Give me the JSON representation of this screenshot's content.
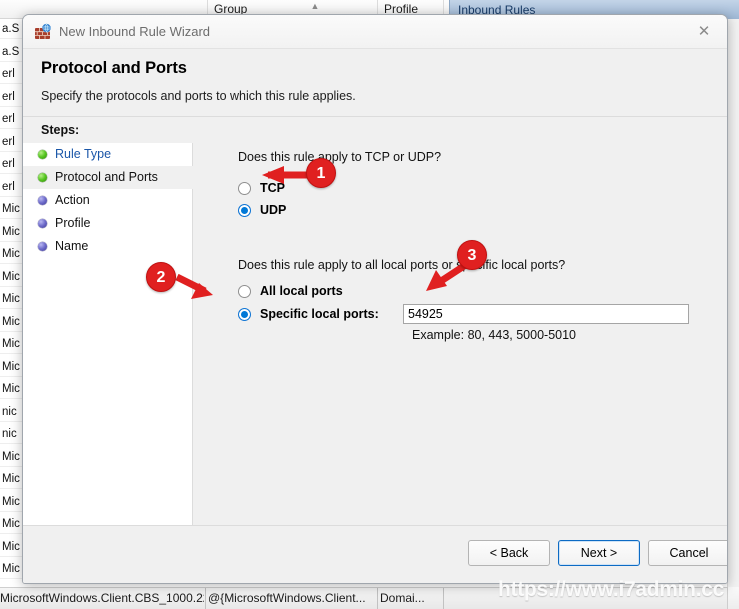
{
  "background": {
    "columns": [
      "",
      "",
      "Group",
      "Profile",
      ""
    ],
    "col_group": "Group",
    "col_profile": "Profile",
    "action_pane_title": "Inbound Rules",
    "rows": [
      "a.S",
      "a.S",
      "erl",
      "erl",
      "erl",
      "erl",
      "erl",
      "erl",
      "Mic",
      "Mic",
      "Mic",
      "Mic",
      "Mic",
      "Mic",
      "Mic",
      "Mic",
      "Mic",
      "nic",
      "nic",
      "Mic",
      "Mic",
      "Mic",
      "Mic",
      "Mic",
      "Mic"
    ],
    "status": {
      "cell1": "MicrosoftWindows.Client.CBS_1000.22...",
      "cell2": "@{MicrosoftWindows.Client...",
      "cell3": "Domai..."
    }
  },
  "dialog": {
    "title": "New Inbound Rule Wizard",
    "title_icon": "firewall-icon",
    "close_icon": "close-icon",
    "page_title": "Protocol and Ports",
    "page_subtitle": "Specify the protocols and ports to which this rule applies.",
    "steps_header": "Steps:",
    "steps": [
      {
        "label": "Rule Type",
        "state": "done",
        "current": false,
        "link": true
      },
      {
        "label": "Protocol and Ports",
        "state": "done",
        "current": true,
        "link": false
      },
      {
        "label": "Action",
        "state": "todo",
        "current": false,
        "link": false
      },
      {
        "label": "Profile",
        "state": "todo",
        "current": false,
        "link": false
      },
      {
        "label": "Name",
        "state": "todo",
        "current": false,
        "link": false
      }
    ],
    "content": {
      "question_protocol": "Does this rule apply to TCP or UDP?",
      "protocol_options": [
        {
          "label": "TCP",
          "checked": false
        },
        {
          "label": "UDP",
          "checked": true
        }
      ],
      "question_ports": "Does this rule apply to all local ports or specific local ports?",
      "port_options": [
        {
          "label": "All local ports",
          "checked": false
        },
        {
          "label": "Specific local ports:",
          "checked": true
        }
      ],
      "port_value": "54925",
      "port_placeholder": "",
      "port_example": "Example: 80, 443, 5000-5010"
    },
    "buttons": {
      "back": "< Back",
      "next": "Next >",
      "cancel": "Cancel"
    }
  },
  "annotations": {
    "badge1": "1",
    "badge2": "2",
    "badge3": "3",
    "color": "#e02020"
  },
  "watermark": "https://www.i7admin.cc"
}
